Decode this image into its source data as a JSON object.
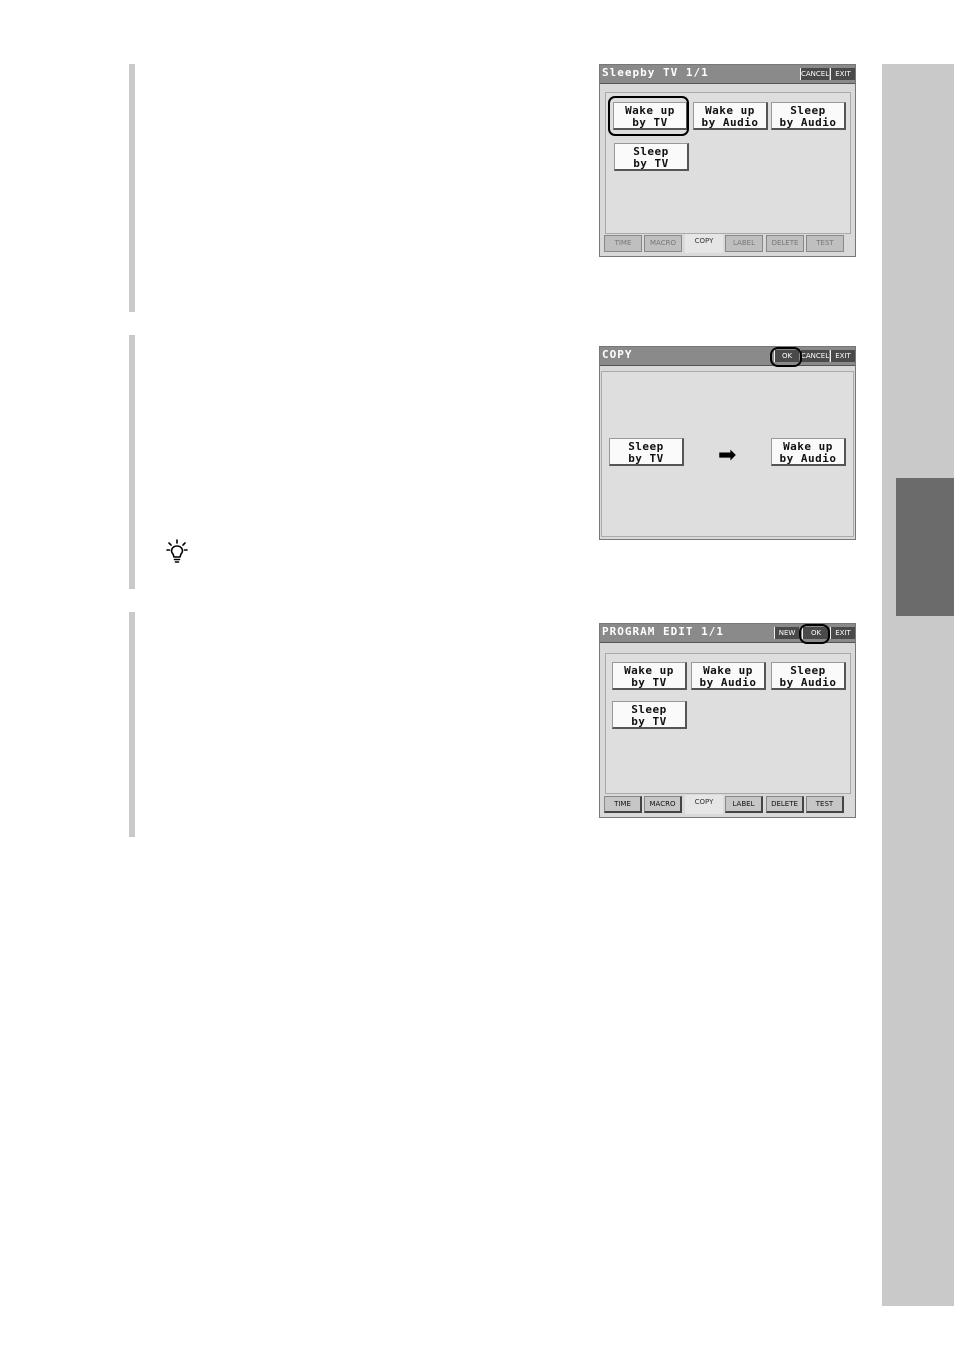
{
  "screen1": {
    "title": "Sleepby TV 1/1",
    "cancel_label": "CANCEL",
    "exit_label": "EXIT",
    "buttons": [
      {
        "line1": "Wake up",
        "line2": "by TV"
      },
      {
        "line1": "Wake up",
        "line2": "by Audio"
      },
      {
        "line1": "Sleep",
        "line2": "by Audio"
      },
      {
        "line1": "Sleep",
        "line2": "by TV"
      }
    ],
    "tabs": [
      "TIME",
      "MACRO",
      "COPY",
      "LABEL",
      "DELETE",
      "TEST"
    ],
    "highlighted_button": "Wake up by TV"
  },
  "screen2": {
    "title": "COPY",
    "ok_label": "OK",
    "cancel_label": "CANCEL",
    "exit_label": "EXIT",
    "source": {
      "line1": "Sleep",
      "line2": "by TV"
    },
    "arrow": "➡",
    "target": {
      "line1": "Wake up",
      "line2": "by Audio"
    },
    "highlighted_button": "OK"
  },
  "screen3": {
    "title": "PROGRAM EDIT 1/1",
    "new_label": "NEW",
    "ok_label": "OK",
    "exit_label": "EXIT",
    "buttons": [
      {
        "line1": "Wake up",
        "line2": "by TV"
      },
      {
        "line1": "Wake up",
        "line2": "by Audio"
      },
      {
        "line1": "Sleep",
        "line2": "by Audio"
      },
      {
        "line1": "Sleep",
        "line2": "by TV"
      }
    ],
    "tabs": [
      "TIME",
      "MACRO",
      "COPY",
      "LABEL",
      "DELETE",
      "TEST"
    ],
    "highlighted_button": "OK"
  },
  "icons": {
    "tip": "lightbulb-icon"
  },
  "colors": {
    "side_strip": "#c9c9c9",
    "side_tab": "#6b6b6b",
    "titlebar": "#8a8a8a"
  }
}
